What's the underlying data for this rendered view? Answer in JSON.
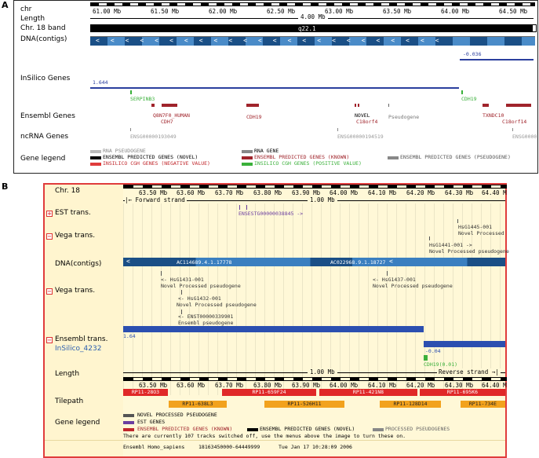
{
  "panelA": {
    "letter": "A",
    "labels": {
      "chr": "chr",
      "length": "Length",
      "band": "Chr. 18 band",
      "dna": "DNA(contigs)",
      "insilico": "InSilico Genes",
      "ensembl": "Ensembl Genes",
      "ncrna": "ncRNA Genes",
      "legend": "Gene legend"
    },
    "ticks": [
      "61.00 Mb",
      "61.50 Mb",
      "62.00 Mb",
      "62.50 Mb",
      "63.00 Mb",
      "63.50 Mb",
      "64.00 Mb",
      "64.50 Mb"
    ],
    "length_text": "4.00 Mb",
    "band_text": "q22.1",
    "insilico_left_value": "1.644",
    "insilico_right_value": "-0.036",
    "green_genes": [
      "SERPINB3",
      "CDH19"
    ],
    "ensembl_gene_labels": [
      "Q8N7F0_HUMAN",
      "CDH7",
      "CDH19",
      "NOVEL",
      "C18orf4",
      "Pseudogene",
      "TXNDC10",
      "C18orf14"
    ],
    "ncrna_labels": [
      "ENSG00000193049",
      "ENSG00000194519",
      "ENSG0000"
    ],
    "legend": {
      "rna_pseudogene": "RNA PSEUDOGENE",
      "ens_novel": "ENSEMBL PREDICTED GENES (NOVEL)",
      "insilico_neg": "INSILICO CGH GENES (NEGATIVE VALUE)",
      "rna_gene": "RNA GENE",
      "ens_known": "ENSEMBL PREDICTED GENES (KNOWN)",
      "insilico_pos": "INSILICO CGH GENES (POSITIVE VALUE)",
      "ens_pseudo": "ENSEMBL PREDICTED GENES (PSEUDOGENE)"
    }
  },
  "panelB": {
    "letter": "B",
    "labels": {
      "chr": "Chr. 18",
      "est": "EST trans.",
      "vega1": "Vega trans.",
      "dna": "DNA(contigs)",
      "vega2": "Vega trans.",
      "ensembl": "Ensembl trans.",
      "insilico": "InSilico_4232",
      "length": "Length",
      "tilepath": "Tilepath",
      "legend": "Gene legend"
    },
    "ticks": [
      "63.50 Mb",
      "63.60 Mb",
      "63.70 Mb",
      "63.80 Mb",
      "63.90 Mb",
      "64.00 Mb",
      "64.10 Mb",
      "64.20 Mb",
      "64.30 Mb",
      "64.40 M"
    ],
    "forward_strand": "Forward strand",
    "scale_text": "1.00 Mb",
    "reverse_strand": "Reverse strand",
    "est_gene": "ENSESTG00000038845 ->",
    "vega_top": [
      {
        "name": "HsG1445-001",
        "desc": "Novel Processed"
      },
      {
        "name": "HsG1441-001 ->",
        "desc": "Novel Processed pseudogene"
      }
    ],
    "contig_labels": [
      "AC114689.4.1.17778",
      "AC022968.9.1.18727"
    ],
    "vega_bottom": [
      {
        "name": "<- HsG1431-001",
        "desc": "Novel Processed pseudogene"
      },
      {
        "name": "<- HsG1432-001",
        "desc": "Novel Processed pseudogene"
      },
      {
        "name": "<- HsG1437-001",
        "desc": "Novel Processed pseudogene"
      }
    ],
    "ensembl_trans": {
      "name": "<- ENST00000339901",
      "desc": "Ensembl pseudogene"
    },
    "insilico_left_value": "1.64",
    "insilico_right_value": "-0.04",
    "cdh19": "CDH19(0.01)",
    "tilepath_top": [
      "RP11-28O3",
      "RP11-659F24",
      "RP11-421N8",
      "RP11-695K6"
    ],
    "tilepath_bottom": [
      "RP11-638L3",
      "RP11-526H11",
      "RP11-128D14",
      "RP11-734E"
    ],
    "legend": {
      "novel_proc": "NOVEL PROCESSED PSEUDOGENE",
      "est": "EST GENES",
      "ens_known": "ENSEMBL PREDICTED GENES (KNOWN)",
      "ens_novel": "ENSEMBL PREDICTED GENES (NOVEL)",
      "proc_pseudo": "PROCESSED PSEUDOGENES"
    },
    "tracks_note": "There are currently 107 tracks switched off, use the menus above the image to turn these on.",
    "footer": {
      "species": "Ensembl Homo_sapiens",
      "range": "18163450000-64449999",
      "date": "Tue Jan 17 10:28:09 2006"
    }
  }
}
